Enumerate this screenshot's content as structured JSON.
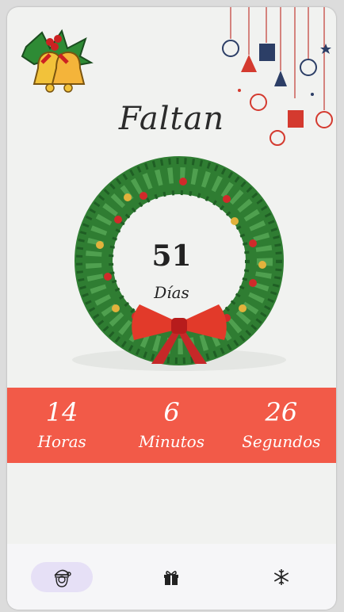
{
  "header": {
    "title": "Faltan"
  },
  "countdown": {
    "days": {
      "value": "51",
      "label": "Días"
    },
    "hours": {
      "value": "14",
      "label": "Horas"
    },
    "minutes": {
      "value": "6",
      "label": "Minutos"
    },
    "seconds": {
      "value": "26",
      "label": "Segundos"
    }
  },
  "navbar": {
    "items": [
      {
        "icon": "santa-icon",
        "active": true
      },
      {
        "icon": "gift-icon",
        "active": false
      },
      {
        "icon": "snowflake-icon",
        "active": false
      }
    ]
  },
  "colors": {
    "band": "#f25a48",
    "nav_active": "#e6e0f6",
    "background": "#f1f2f0"
  }
}
